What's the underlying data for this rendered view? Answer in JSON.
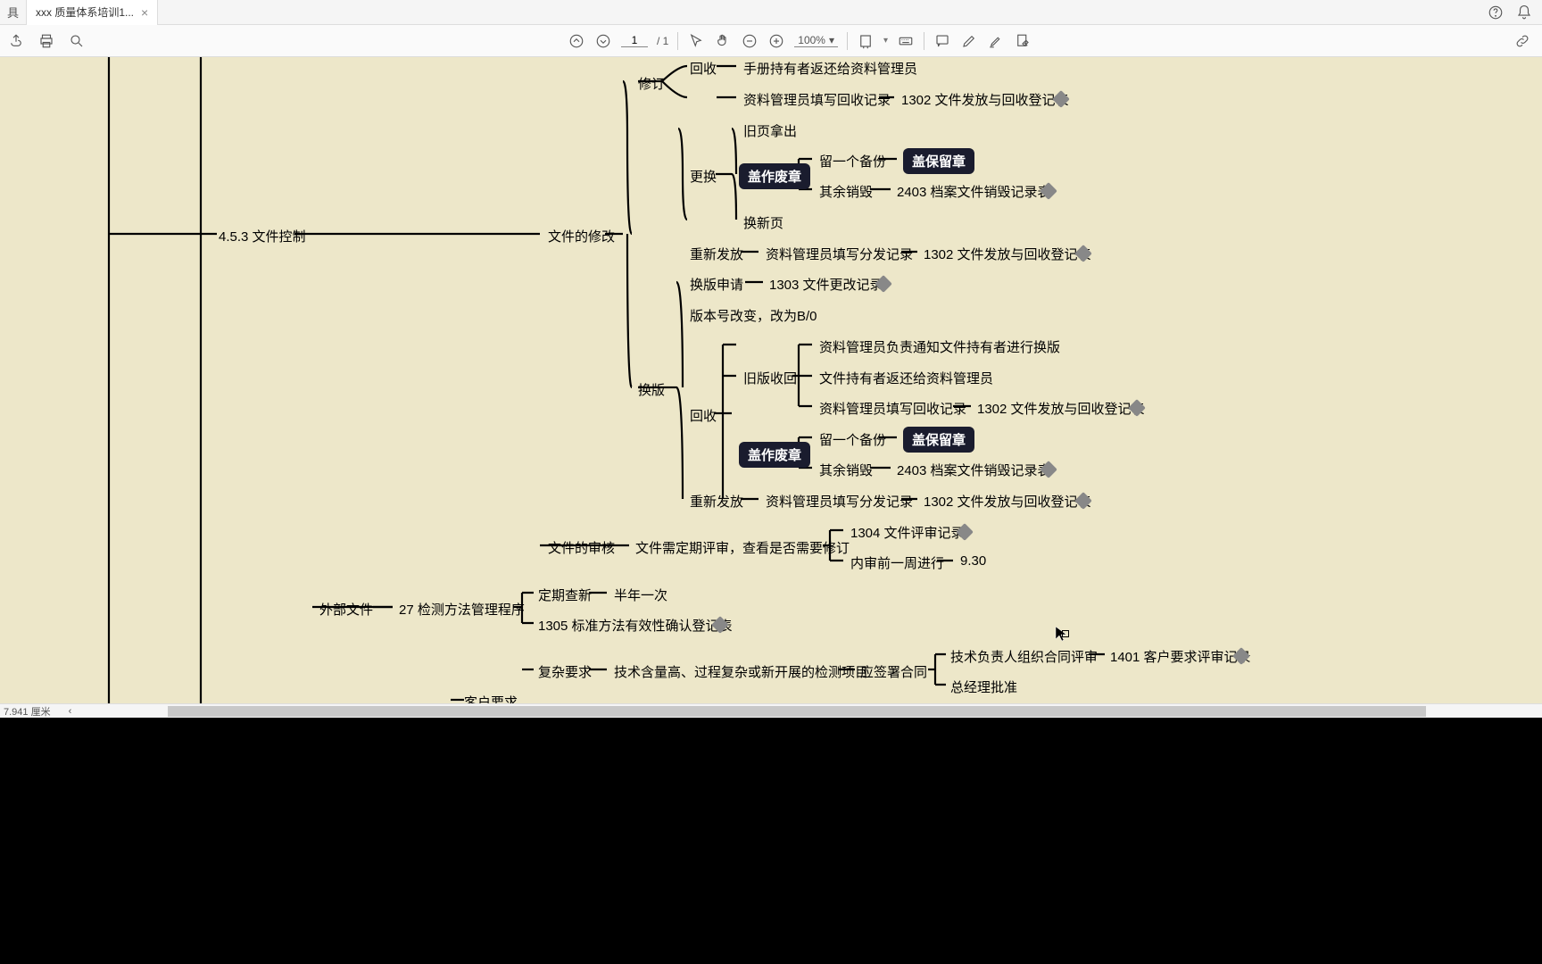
{
  "titlebar": {
    "stub_label": "具",
    "tab_title": "xxx 质量体系培训1...",
    "close": "×"
  },
  "toolbar": {
    "page_current": "1",
    "page_total": "/ 1",
    "zoom": "100%",
    "dropdown_caret": "▾"
  },
  "status": {
    "coord": "7.941 厘米",
    "scroll_left": "‹"
  },
  "mindmap": {
    "n_453": "4.5.3 文件控制",
    "n_doc_modify": "文件的修改",
    "n_xiuding": "修订",
    "n_huishou1": "回收",
    "n_shouce": "手册持有者返还给资料管理员",
    "n_ziliao_huishou": "资料管理员填写回收记录",
    "n_1302_1": "1302 文件发放与回收登记表",
    "n_genghuan": "更换",
    "n_jiuye": "旧页拿出",
    "n_gaizuofei1": "盖作废章",
    "n_liubeifen1": "留一个备份",
    "n_gaibaoliu1": "盖保留章",
    "n_qiyuxiaohu1": "其余销毁",
    "n_2403_1": "2403 档案文件销毁记录表",
    "n_huanxinye": "换新页",
    "n_chongxin1": "重新发放",
    "n_ziliao_fenfa1": "资料管理员填写分发记录",
    "n_1302_2": "1302 文件发放与回收登记表",
    "n_huanban": "换版",
    "n_huanban_shenqing": "换版申请",
    "n_1303": "1303 文件更改记录",
    "n_banben": "版本号改变，改为B/0",
    "n_huishou2": "回收",
    "n_jiuban_shouhui": "旧版收回",
    "n_ziliao_tongzhi": "资料管理员负责通知文件持有者进行换版",
    "n_wenjian_fanhuan": "文件持有者返还给资料管理员",
    "n_ziliao_huishou2": "资料管理员填写回收记录",
    "n_1302_3": "1302 文件发放与回收登记表",
    "n_gaizuofei2": "盖作废章",
    "n_liubeifen2": "留一个备份",
    "n_gaibaoliu2": "盖保留章",
    "n_qiyuxiaohu2": "其余销毁",
    "n_2403_2": "2403 档案文件销毁记录表",
    "n_chongxin2": "重新发放",
    "n_ziliao_fenfa2": "资料管理员填写分发记录",
    "n_1302_4": "1302 文件发放与回收登记表",
    "n_wenjian_shenhe": "文件的审核",
    "n_dingqi_pingshen": "文件需定期评审，查看是否需要修订",
    "n_1304": "1304 文件评审记录",
    "n_neishen": "内审前一周进行",
    "n_930": "9.30",
    "n_waibu": "外部文件",
    "n_27": "27 检测方法管理程序",
    "n_dingqi_chaxin": "定期查新",
    "n_bannian": "半年一次",
    "n_1305": "1305 标准方法有效性确认登记表",
    "n_kehu": "客户要求",
    "n_fuza": "复杂要求",
    "n_jishu": "技术含量高、过程复杂或新开展的检测项目",
    "n_yingqian": "应签署合同",
    "n_jishu_fuze": "技术负责人组织合同评审",
    "n_1401": "1401 客户要求评审记录",
    "n_zongjingli": "总经理批准"
  }
}
